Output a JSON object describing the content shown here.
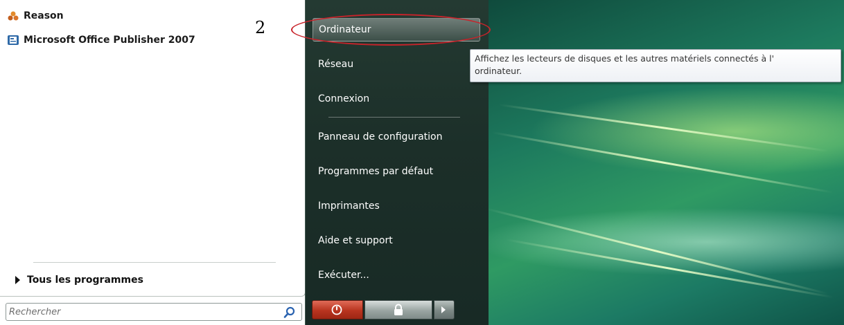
{
  "annotation": {
    "number": "2"
  },
  "recent_programs": [
    {
      "label": "Reason",
      "icon": "reason-icon"
    },
    {
      "label": "Microsoft Office Publisher 2007",
      "icon": "publisher-icon"
    }
  ],
  "all_programs": {
    "label": "Tous les programmes"
  },
  "search": {
    "placeholder": "Rechercher",
    "value": ""
  },
  "places": [
    {
      "label": "Ordinateur",
      "highlighted": true
    },
    {
      "label": "Réseau"
    },
    {
      "label": "Connexion"
    },
    {
      "label": "Panneau de configuration"
    },
    {
      "label": "Programmes par défaut"
    },
    {
      "label": "Imprimantes"
    },
    {
      "label": "Aide et support"
    },
    {
      "label": "Exécuter..."
    }
  ],
  "tooltip": {
    "line1": "Affichez les lecteurs de disques et les autres matériels connectés à l'",
    "line2": "ordinateur."
  },
  "power_buttons": {
    "power_icon": "power-icon",
    "lock_icon": "lock-icon",
    "more_icon": "arrow-right-icon"
  },
  "colors": {
    "annotation_ring": "#c8232a",
    "power_button": "#b8341f",
    "right_panel": "#1c2f29"
  }
}
